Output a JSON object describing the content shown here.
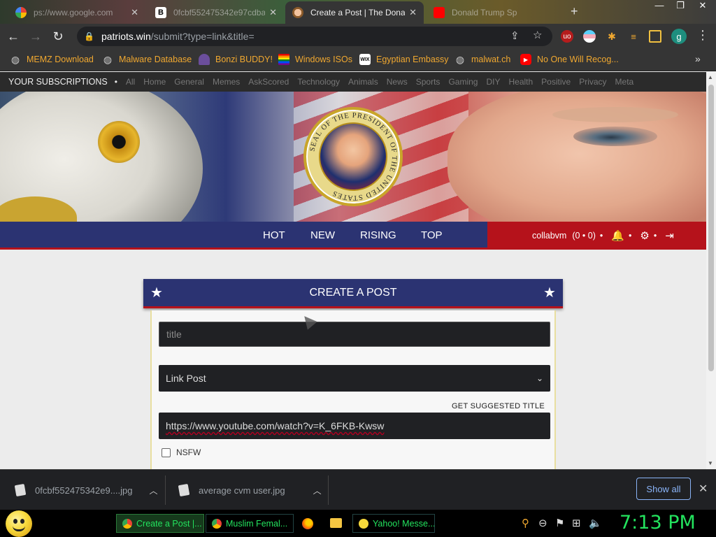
{
  "tabs": [
    {
      "title": "ps://www.google.com",
      "icon": "google-icon",
      "active": false
    },
    {
      "title": "0fcbf552475342e97cdba",
      "icon": "b-icon",
      "active": false
    },
    {
      "title": "Create a Post | The Donald",
      "icon": "trump-icon",
      "active": true
    },
    {
      "title": "Donald Trump Sp",
      "icon": "youtube-icon",
      "active": false
    }
  ],
  "address": {
    "host": "patriots.win",
    "path": "/submit?type=link&title="
  },
  "profile_initial": "g",
  "bookmarks": [
    {
      "label": "MEMZ Download",
      "icon": "globe-icon"
    },
    {
      "label": "Malware Database",
      "icon": "globe-icon"
    },
    {
      "label": "Bonzi BUDDY!",
      "icon": "bonzi-icon"
    },
    {
      "label": "Windows ISOs",
      "icon": "rainbow-flag-icon"
    },
    {
      "label": "Egyptian Embassy",
      "icon": "wix-icon"
    },
    {
      "label": "malwat.ch",
      "icon": "globe-icon"
    },
    {
      "label": "No One Will Recog...",
      "icon": "youtube-icon"
    }
  ],
  "subscriptions": {
    "label": "YOUR SUBSCRIPTIONS",
    "links": [
      "All",
      "Home",
      "General",
      "Memes",
      "AskScored",
      "Technology",
      "Animals",
      "News",
      "Sports",
      "Gaming",
      "DIY",
      "Health",
      "Positive",
      "Privacy",
      "Meta"
    ]
  },
  "seal": {
    "text": "SEAL OF THE PRESIDENT OF THE UNITED STATES"
  },
  "sort": [
    "HOT",
    "NEW",
    "RISING",
    "TOP"
  ],
  "user": {
    "name": "collabvm",
    "score": "(0 • 0)"
  },
  "post": {
    "header": "CREATE A POST",
    "title_placeholder": "title",
    "type_selected": "Link Post",
    "suggest_label": "GET SUGGESTED TITLE",
    "url_value": "https://www.youtube.com/watch?v=K_6FKB-Kwsw",
    "nsfw_label": "NSFW"
  },
  "downloads": [
    {
      "name": "0fcbf552475342e9....jpg"
    },
    {
      "name": "average cvm user.jpg"
    }
  ],
  "show_all": "Show all",
  "taskbar": [
    {
      "label": "Create a Post |...",
      "active": true
    },
    {
      "label": "Muslim Femal...",
      "active": false
    },
    {
      "label": "Yahoo! Messe...",
      "active": false
    }
  ],
  "clock": "7:13 PM",
  "colors": {
    "navy": "#2b3372",
    "red": "#b5121b",
    "taskbar_text": "#23e35e",
    "bookmark_text": "#f0a830"
  }
}
